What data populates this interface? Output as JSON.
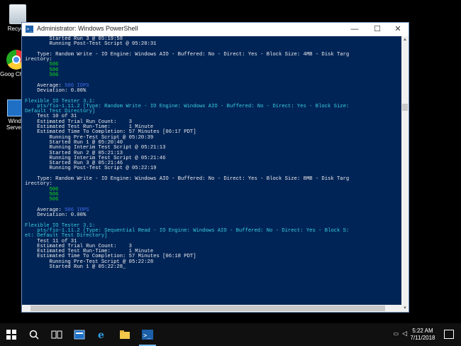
{
  "desktop": {
    "icons": [
      {
        "label": "Recycle",
        "icon": "recycle-bin-icon"
      },
      {
        "label": "Goog Chrom",
        "icon": "chrome-icon"
      },
      {
        "label": "Windo Server I",
        "icon": "server-manager-icon"
      }
    ]
  },
  "window": {
    "title": "Administrator: Windows PowerShell",
    "minimize": "—",
    "maximize": "☐",
    "close": "✕"
  },
  "console": {
    "lines": [
      {
        "text": "        Started Run 3 @ 05:19:58",
        "color": "white"
      },
      {
        "text": "        Running Post-Test Script @ 05:20:31",
        "color": "white"
      },
      {
        "text": "",
        "color": "white"
      },
      {
        "text": "    Type: Random Write - IO Engine: Windows AIO - Buffered: No - Direct: Yes - Block Size: 4MB - Disk Targ",
        "color": "white"
      },
      {
        "text": "irectory:",
        "color": "white"
      },
      {
        "text": "        506",
        "color": "green"
      },
      {
        "text": "        506",
        "color": "green"
      },
      {
        "text": "        506",
        "color": "green"
      },
      {
        "text": "",
        "color": "white"
      },
      {
        "text": "    Average: ",
        "color": "white",
        "highlight": "506 IOPS"
      },
      {
        "text": "    Deviation: 0.00%",
        "color": "white"
      },
      {
        "text": "",
        "color": "white"
      },
      {
        "text": "Flexible IO Tester 3.1:",
        "color": "cyan"
      },
      {
        "text": "    pts/fio-1.11.2 [Type: Random Write - IO Engine: Windows AIO - Buffered: No - Direct: Yes - Block Size:",
        "color": "cyan"
      },
      {
        "text": "Default Test Directory]",
        "color": "cyan"
      },
      {
        "text": "    Test 10 of 31",
        "color": "white"
      },
      {
        "text": "    Estimated Trial Run Count:    3",
        "color": "white"
      },
      {
        "text": "    Estimated Test Run-Time:      1 Minute",
        "color": "white"
      },
      {
        "text": "    Estimated Time To Completion: 57 Minutes [06:17 PDT]",
        "color": "white"
      },
      {
        "text": "        Running Pre-Test Script @ 05:20:39",
        "color": "white"
      },
      {
        "text": "        Started Run 1 @ 05:20:40",
        "color": "white"
      },
      {
        "text": "        Running Interim Test Script @ 05:21:13",
        "color": "white"
      },
      {
        "text": "        Started Run 2 @ 05:21:13",
        "color": "white"
      },
      {
        "text": "        Running Interim Test Script @ 05:21:46",
        "color": "white"
      },
      {
        "text": "        Started Run 3 @ 05:21:46",
        "color": "white"
      },
      {
        "text": "        Running Post-Test Script @ 05:22:19",
        "color": "white"
      },
      {
        "text": "",
        "color": "white"
      },
      {
        "text": "    Type: Random Write - IO Engine: Windows AIO - Buffered: No - Direct: Yes - Block Size: 8MB - Disk Targ",
        "color": "white"
      },
      {
        "text": "irectory:",
        "color": "white"
      },
      {
        "text": "        506",
        "color": "green"
      },
      {
        "text": "        506",
        "color": "green"
      },
      {
        "text": "        506",
        "color": "green"
      },
      {
        "text": "",
        "color": "white"
      },
      {
        "text": "    Average: ",
        "color": "white",
        "highlight": "506 IOPS"
      },
      {
        "text": "    Deviation: 0.00%",
        "color": "white"
      },
      {
        "text": "",
        "color": "white"
      },
      {
        "text": "Flexible IO Tester 3.1:",
        "color": "cyan"
      },
      {
        "text": "    pts/fio-1.11.2 [Type: Sequential Read - IO Engine: Windows AIO - Buffered: No - Direct: Yes - Block S:",
        "color": "cyan"
      },
      {
        "text": "et: Default Test Directory]",
        "color": "cyan"
      },
      {
        "text": "    Test 11 of 31",
        "color": "white"
      },
      {
        "text": "    Estimated Trial Run Count:    3",
        "color": "white"
      },
      {
        "text": "    Estimated Test Run-Time:      1 Minute",
        "color": "white"
      },
      {
        "text": "    Estimated Time To Completion: 57 Minutes [06:18 PDT]",
        "color": "white"
      },
      {
        "text": "        Running Pre-Test Script @ 05:22:28",
        "color": "white"
      },
      {
        "text": "        Started Run 1 @ 05:22:28_",
        "color": "white"
      }
    ]
  },
  "taskbar": {
    "items": [
      {
        "name": "start-button",
        "icon": "windows-logo-icon"
      },
      {
        "name": "search-button",
        "icon": "search-icon"
      },
      {
        "name": "task-view-button",
        "icon": "task-view-icon"
      },
      {
        "name": "server-manager-taskbar",
        "icon": "server-manager-icon"
      },
      {
        "name": "internet-explorer-taskbar",
        "icon": "ie-icon"
      },
      {
        "name": "file-explorer-taskbar",
        "icon": "folder-icon"
      },
      {
        "name": "powershell-taskbar",
        "icon": "powershell-icon"
      }
    ],
    "time": "5:22 AM",
    "date": "7/11/2018"
  },
  "colors": {
    "console_bg": "#012456",
    "console_text": "#eeedf0",
    "green": "#13e013",
    "cyan": "#3ad0e0",
    "taskbar": "#101010"
  }
}
